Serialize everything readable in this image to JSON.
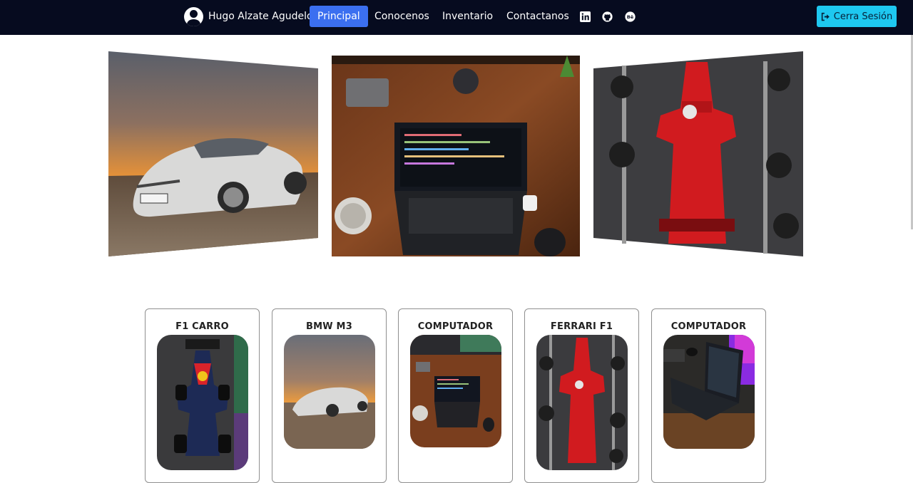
{
  "navbar": {
    "user_name": "Hugo Alzate Agudelo",
    "links": [
      "Principal",
      "Conocenos",
      "Inventario",
      "Contactanos"
    ],
    "active_link": "Principal",
    "social_icons": [
      "linkedin-icon",
      "github-icon",
      "behance-icon"
    ],
    "behance_glyph": "Bē",
    "logout_label": "Cerra Sesión"
  },
  "hero": {
    "images": [
      "bmw-m3-sunset",
      "laptop-desk",
      "ferrari-f1-pitstop"
    ]
  },
  "cards": [
    {
      "title": "F1 CARRO",
      "image": "red-bull-f1-car"
    },
    {
      "title": "BMW M3",
      "image": "bmw-m3-sunset"
    },
    {
      "title": "COMPUTADOR",
      "image": "laptop-desk"
    },
    {
      "title": "FERRARI F1",
      "image": "ferrari-f1-car"
    },
    {
      "title": "COMPUTADOR",
      "image": "gaming-laptop"
    }
  ],
  "colors": {
    "navbar_bg": "#060b1f",
    "active_link_bg": "#3b6ff0",
    "logout_bg": "#1ec8f0"
  }
}
